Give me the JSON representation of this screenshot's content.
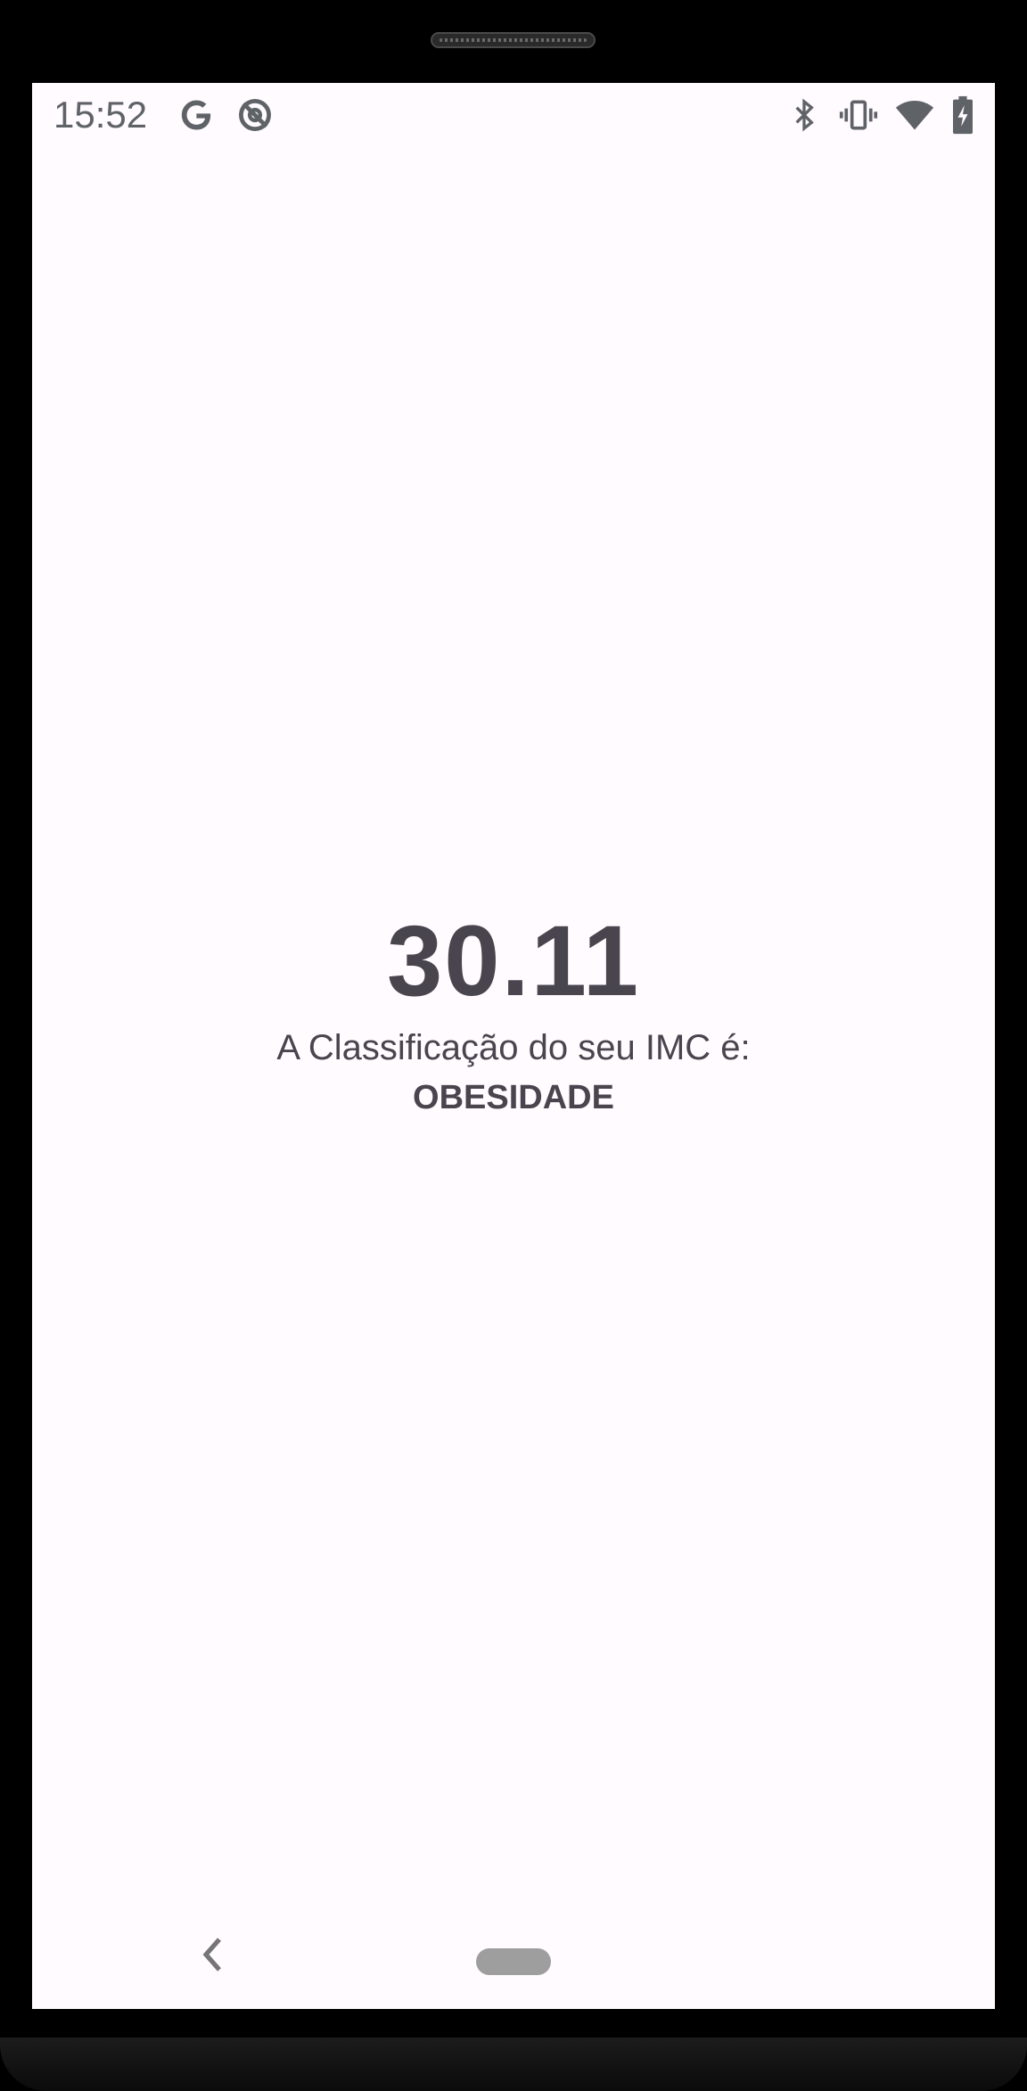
{
  "status_bar": {
    "time": "15:52",
    "left_icons": [
      "google-g-icon",
      "no-location-icon"
    ],
    "right_icons": [
      "bluetooth-icon",
      "vibrate-icon",
      "wifi-icon",
      "battery-charging-icon"
    ]
  },
  "result": {
    "imc_value": "30.11",
    "label": "A Classificação do seu IMC é:",
    "classification": "OBESIDADE"
  },
  "nav_bar": {
    "icons": [
      "back-icon",
      "home-pill-icon"
    ]
  },
  "colors": {
    "background": "#fffbfe",
    "text": "#49454f",
    "status_icons": "#5f6368",
    "device_frame": "#000000"
  }
}
